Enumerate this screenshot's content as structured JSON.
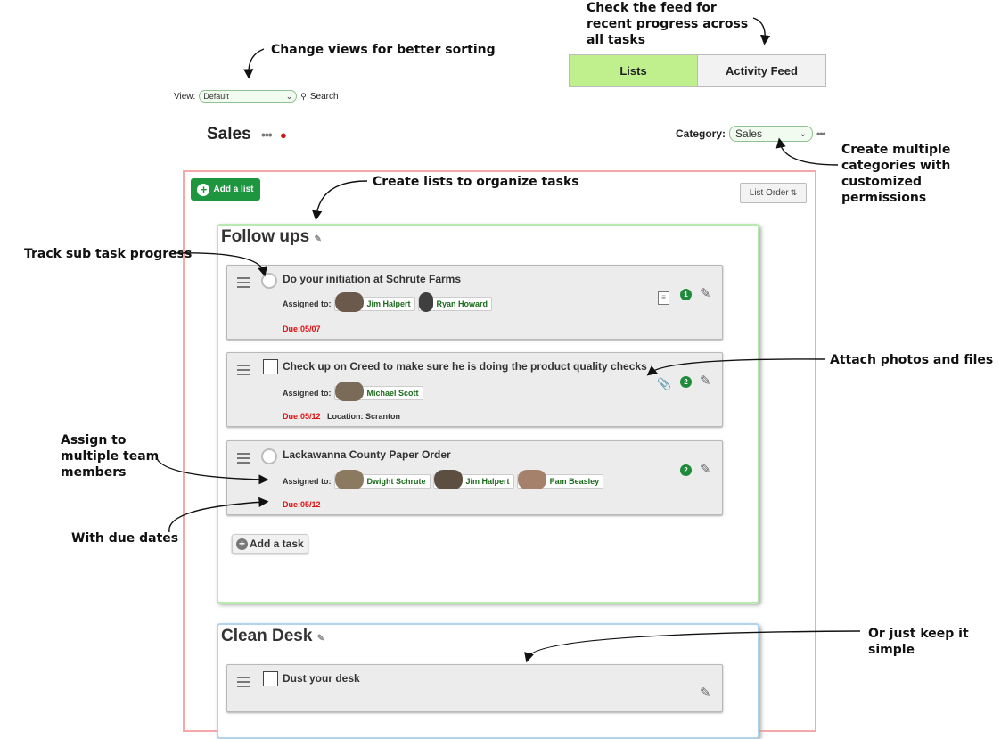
{
  "tabs": {
    "lists": "Lists",
    "activity": "Activity Feed"
  },
  "view": {
    "label": "View:",
    "selected": "Default",
    "search": "Search"
  },
  "category": {
    "label": "Category:",
    "selected": "Sales"
  },
  "board": {
    "title": "Sales",
    "add_list": "Add a list",
    "list_order": "List Order"
  },
  "lists": [
    {
      "title": "Follow ups",
      "tasks": [
        {
          "title": "Do your initiation at Schrute Farms",
          "assigned_label": "Assigned to:",
          "assignees": [
            "Jim Halpert",
            "Ryan Howard"
          ],
          "due": "Due:05/07",
          "count": "1"
        },
        {
          "title": "Check up on Creed to make sure he is doing the product quality checks",
          "assigned_label": "Assigned to:",
          "assignees": [
            "Michael Scott"
          ],
          "due": "Due:05/12",
          "location": "Location: Scranton",
          "count": "2"
        },
        {
          "title": "Lackawanna County Paper Order",
          "assigned_label": "Assigned to:",
          "assignees": [
            "Dwight Schrute",
            "Jim Halpert",
            "Pam Beasley"
          ],
          "due": "Due:05/12",
          "count": "2"
        }
      ],
      "add_task": "Add a task"
    },
    {
      "title": "Clean Desk",
      "tasks": [
        {
          "title": "Dust your desk"
        }
      ]
    }
  ],
  "annotations": {
    "feed": "Check the feed for recent progress across all tasks",
    "views": "Change views for better sorting",
    "categories": "Create multiple categories with customized permissions",
    "lists": "Create lists to organize tasks",
    "subtask": "Track sub task progress",
    "attach": "Attach photos and files",
    "assign": "Assign to multiple team members",
    "due": "With due dates",
    "simple": "Or just keep it simple"
  },
  "colors": {
    "accent_green": "#1e9640",
    "tab_active": "#bff08d",
    "due_red": "#e01010",
    "board_border": "#f4a8a8"
  }
}
